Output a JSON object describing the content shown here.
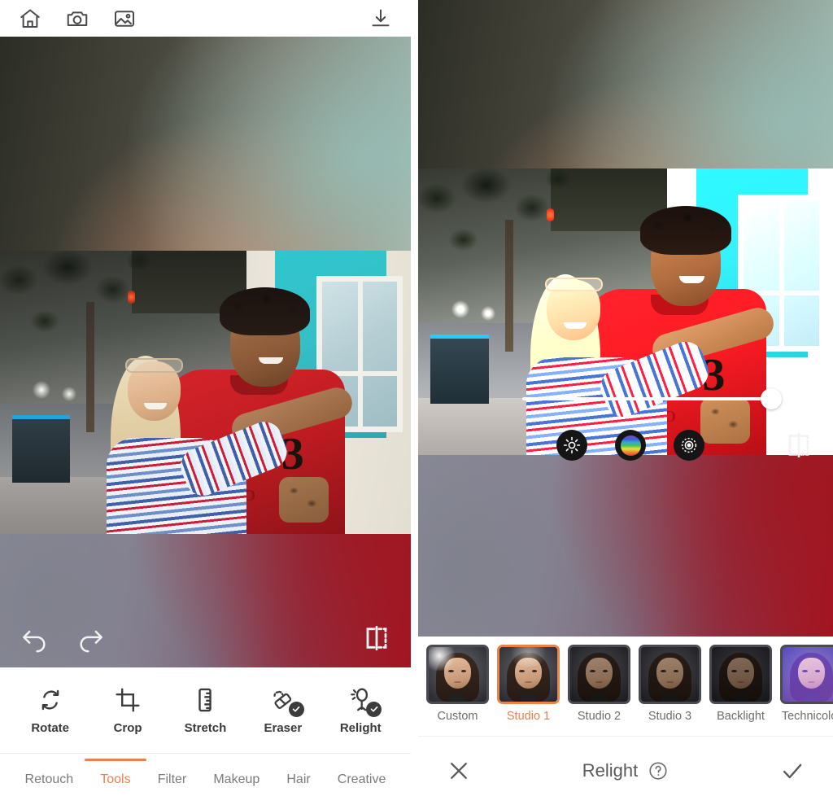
{
  "app": {
    "accent_color": "#E8834A",
    "icon_color": "#4A4A4A"
  },
  "left_panel": {
    "topbar": {
      "home_label": "home-icon",
      "camera_label": "camera-icon",
      "gallery_label": "gallery-icon",
      "save_label": "download-icon"
    },
    "canvas": {
      "undo_label": "undo-icon",
      "redo_label": "redo-icon",
      "compare_label": "compare-icon"
    },
    "tools": [
      {
        "label": "Rotate",
        "icon": "rotate-icon",
        "badge": false
      },
      {
        "label": "Crop",
        "icon": "crop-icon",
        "badge": false
      },
      {
        "label": "Stretch",
        "icon": "stretch-icon",
        "badge": false
      },
      {
        "label": "Eraser",
        "icon": "eraser-icon",
        "badge": true
      },
      {
        "label": "Relight",
        "icon": "relight-icon",
        "badge": true
      }
    ],
    "tabs": [
      {
        "label": "Retouch",
        "active": false
      },
      {
        "label": "Tools",
        "active": true
      },
      {
        "label": "Filter",
        "active": false
      },
      {
        "label": "Makeup",
        "active": false
      },
      {
        "label": "Hair",
        "active": false
      },
      {
        "label": "Creative",
        "active": false
      }
    ]
  },
  "right_panel": {
    "slider": {
      "value_percent": 85,
      "name": "relight-intensity-slider"
    },
    "modes": [
      {
        "name": "brightness-mode-button",
        "icon": "sun-icon"
      },
      {
        "name": "color-mode-button",
        "icon": "color-wheel-icon"
      },
      {
        "name": "light-shape-mode-button",
        "icon": "light-ring-icon"
      }
    ],
    "compare_label": "compare-icon",
    "presets": [
      {
        "label": "Custom",
        "selected": false,
        "style": "custom"
      },
      {
        "label": "Studio 1",
        "selected": true,
        "style": "studio1"
      },
      {
        "label": "Studio 2",
        "selected": false,
        "style": "studio2"
      },
      {
        "label": "Studio 3",
        "selected": false,
        "style": "studio3"
      },
      {
        "label": "Backlight",
        "selected": false,
        "style": "backlight"
      },
      {
        "label": "Technicolor",
        "selected": false,
        "style": "technicolor"
      }
    ],
    "footer": {
      "cancel_label": "close-icon",
      "title": "Relight",
      "help_label": "help-icon",
      "confirm_label": "check-icon"
    }
  }
}
